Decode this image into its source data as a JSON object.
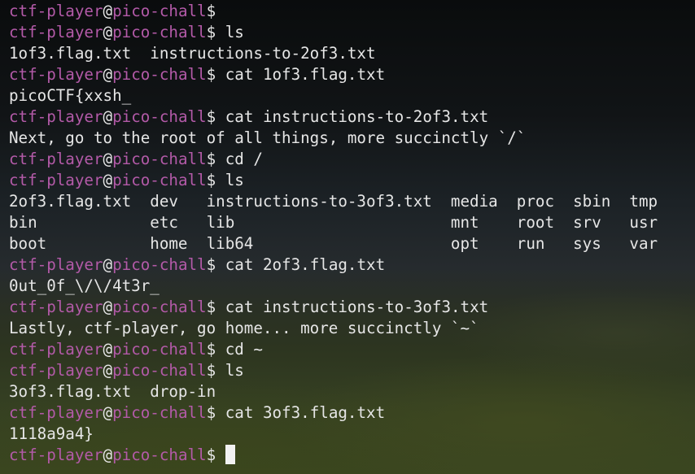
{
  "terminal": {
    "user": "ctf-player",
    "at": "@",
    "host": "pico-chall",
    "prompt_symbol": "$",
    "entries": [
      {
        "type": "prompt",
        "command": ""
      },
      {
        "type": "prompt",
        "command": "ls"
      },
      {
        "type": "output",
        "text": "1of3.flag.txt  instructions-to-2of3.txt"
      },
      {
        "type": "prompt",
        "command": "cat 1of3.flag.txt"
      },
      {
        "type": "output",
        "text": "picoCTF{xxsh_"
      },
      {
        "type": "prompt",
        "command": "cat instructions-to-2of3.txt"
      },
      {
        "type": "output",
        "text": "Next, go to the root of all things, more succinctly `/`"
      },
      {
        "type": "prompt",
        "command": "cd /"
      },
      {
        "type": "prompt",
        "command": "ls"
      },
      {
        "type": "output",
        "text": "2of3.flag.txt  dev   instructions-to-3of3.txt  media  proc  sbin  tmp"
      },
      {
        "type": "output",
        "text": "bin            etc   lib                       mnt    root  srv   usr"
      },
      {
        "type": "output",
        "text": "boot           home  lib64                     opt    run   sys   var"
      },
      {
        "type": "prompt",
        "command": "cat 2of3.flag.txt"
      },
      {
        "type": "output",
        "text": "0ut_0f_\\/\\/4t3r_"
      },
      {
        "type": "prompt",
        "command": "cat instructions-to-3of3.txt"
      },
      {
        "type": "output",
        "text": "Lastly, ctf-player, go home... more succinctly `~`"
      },
      {
        "type": "prompt",
        "command": "cd ~"
      },
      {
        "type": "prompt",
        "command": "ls"
      },
      {
        "type": "output",
        "text": "3of3.flag.txt  drop-in"
      },
      {
        "type": "prompt",
        "command": "cat 3of3.flag.txt"
      },
      {
        "type": "output",
        "text": "1118a9a4}"
      },
      {
        "type": "prompt",
        "command": "",
        "cursor": true
      }
    ]
  },
  "colors": {
    "prompt_user_host": "#b35aa8",
    "text": "#e6e6e6",
    "cursor": "#f2f2f2"
  }
}
